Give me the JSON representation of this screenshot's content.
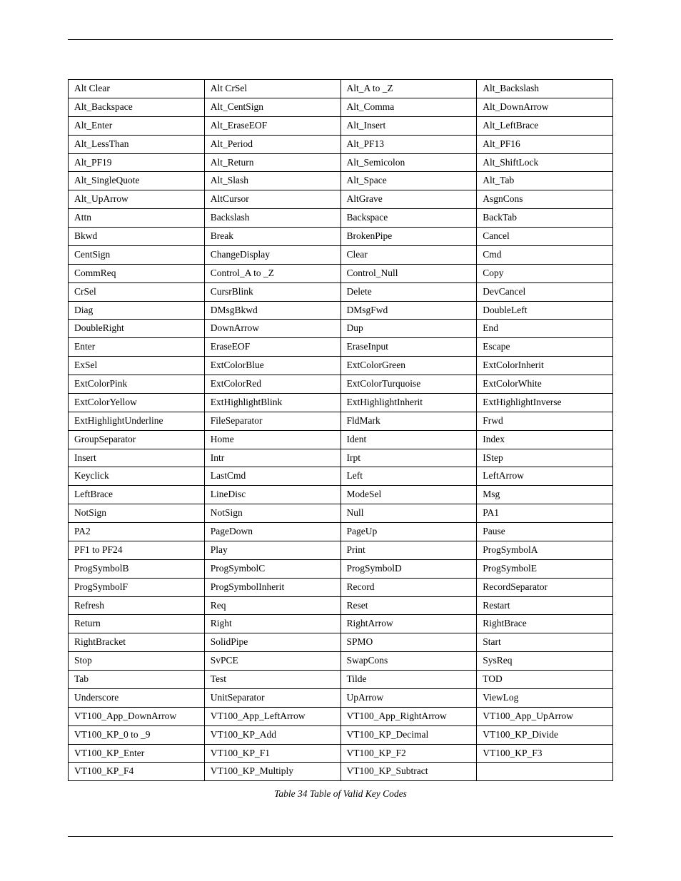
{
  "caption": "Table 34 Table of Valid Key Codes",
  "table_rows": [
    [
      "Alt Clear",
      "Alt CrSel",
      "Alt_A to _Z",
      "Alt_Backslash"
    ],
    [
      "Alt_Backspace",
      "Alt_CentSign",
      "Alt_Comma",
      "Alt_DownArrow"
    ],
    [
      "Alt_Enter",
      "Alt_EraseEOF",
      "Alt_Insert",
      "Alt_LeftBrace"
    ],
    [
      "Alt_LessThan",
      "Alt_Period",
      "Alt_PF13",
      "Alt_PF16"
    ],
    [
      "Alt_PF19",
      "Alt_Return",
      "Alt_Semicolon",
      "Alt_ShiftLock"
    ],
    [
      "Alt_SingleQuote",
      "Alt_Slash",
      "Alt_Space",
      "Alt_Tab"
    ],
    [
      "Alt_UpArrow",
      "AltCursor",
      "AltGrave",
      "AsgnCons"
    ],
    [
      "Attn",
      "Backslash",
      "Backspace",
      "BackTab"
    ],
    [
      "Bkwd",
      "Break",
      "BrokenPipe",
      "Cancel"
    ],
    [
      "CentSign",
      "ChangeDisplay",
      "Clear",
      "Cmd"
    ],
    [
      "CommReq",
      "Control_A to _Z",
      "Control_Null",
      "Copy"
    ],
    [
      "CrSel",
      "CursrBlink",
      "Delete",
      "DevCancel"
    ],
    [
      "Diag",
      "DMsgBkwd",
      "DMsgFwd",
      "DoubleLeft"
    ],
    [
      "DoubleRight",
      "DownArrow",
      "Dup",
      "End"
    ],
    [
      "Enter",
      "EraseEOF",
      "EraseInput",
      "Escape"
    ],
    [
      "ExSel",
      "ExtColorBlue",
      "ExtColorGreen",
      "ExtColorInherit"
    ],
    [
      "ExtColorPink",
      "ExtColorRed",
      "ExtColorTurquoise",
      "ExtColorWhite"
    ],
    [
      "ExtColorYellow",
      "ExtHighlightBlink",
      "ExtHighlightInherit",
      "ExtHighlightInverse"
    ],
    [
      "ExtHighlightUnderline",
      "FileSeparator",
      "FldMark",
      "Frwd"
    ],
    [
      "GroupSeparator",
      "Home",
      "Ident",
      "Index"
    ],
    [
      "Insert",
      "Intr",
      "Irpt",
      "IStep"
    ],
    [
      "Keyclick",
      "LastCmd",
      "Left",
      "LeftArrow"
    ],
    [
      "LeftBrace",
      "LineDisc",
      "ModeSel",
      "Msg"
    ],
    [
      "NotSign",
      "NotSign",
      "Null",
      "PA1"
    ],
    [
      "PA2",
      "PageDown",
      "PageUp",
      "Pause"
    ],
    [
      "PF1 to PF24",
      "Play",
      "Print",
      "ProgSymbolA"
    ],
    [
      "ProgSymbolB",
      "ProgSymbolC",
      "ProgSymbolD",
      "ProgSymbolE"
    ],
    [
      "ProgSymbolF",
      "ProgSymbolInherit",
      "Record",
      "RecordSeparator"
    ],
    [
      "Refresh",
      "Req",
      "Reset",
      "Restart"
    ],
    [
      "Return",
      "Right",
      "RightArrow",
      "RightBrace"
    ],
    [
      "RightBracket",
      "SolidPipe",
      "SPMO",
      "Start"
    ],
    [
      "Stop",
      "SvPCE",
      "SwapCons",
      "SysReq"
    ],
    [
      "Tab",
      "Test",
      "Tilde",
      "TOD"
    ],
    [
      "Underscore",
      "UnitSeparator",
      "UpArrow",
      "ViewLog"
    ],
    [
      "VT100_App_DownArrow",
      "VT100_App_LeftArrow",
      "VT100_App_RightArrow",
      "VT100_App_UpArrow"
    ],
    [
      "VT100_KP_0 to _9",
      "VT100_KP_Add",
      "VT100_KP_Decimal",
      "VT100_KP_Divide"
    ],
    [
      "VT100_KP_Enter",
      "VT100_KP_F1",
      "VT100_KP_F2",
      "VT100_KP_F3"
    ],
    [
      "VT100_KP_F4",
      "VT100_KP_Multiply",
      "VT100_KP_Subtract",
      ""
    ]
  ]
}
